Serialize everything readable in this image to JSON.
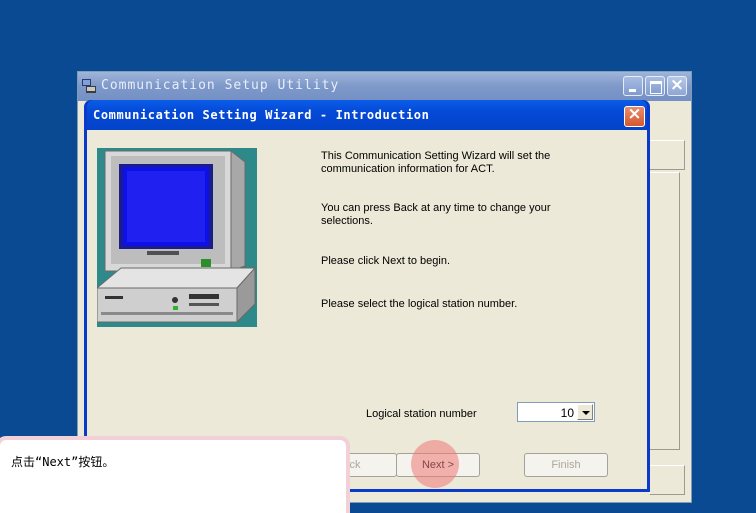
{
  "outer_window": {
    "title": "Communication Setup Utility"
  },
  "wizard": {
    "title": "Communication Setting Wizard - Introduction",
    "paragraph1": "This Communication Setting Wizard will set the communication information for ACT.",
    "paragraph2": "You can press Back at any time to change your selections.",
    "paragraph3": "Please click Next to begin.",
    "paragraph4": "Please select the logical station number.",
    "station_label": "Logical station number",
    "station_value": "10",
    "buttons": {
      "back": "ck",
      "next": "Next >",
      "finish": "Finish"
    }
  },
  "callout": {
    "text": "点击“Next”按钮。"
  },
  "colors": {
    "desktop": "#0a4a93",
    "dialog_face": "#ece9d8",
    "title_blue": "#0549d6",
    "highlight": "#f07878"
  },
  "icons": [
    "app-icon",
    "minimize-icon",
    "maximize-icon",
    "close-icon",
    "computer-illustration",
    "dropdown-arrow-icon"
  ]
}
